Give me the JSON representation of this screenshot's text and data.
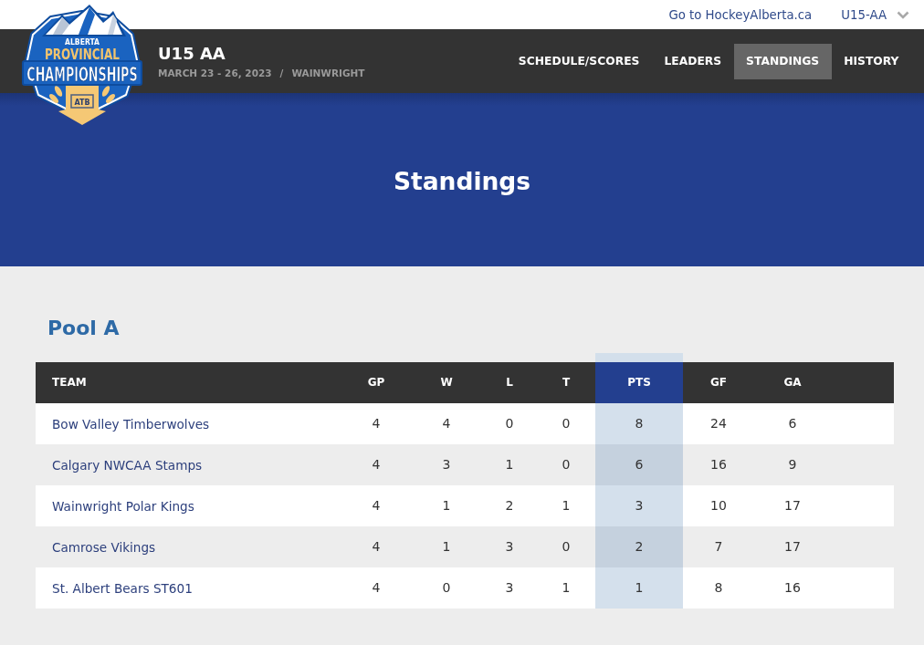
{
  "top_bar": {
    "site_link": "Go to HockeyAlberta.ca",
    "division_select": {
      "value": "U15-AA"
    }
  },
  "logo": {
    "line_1": "ALBERTA",
    "line_2": "PROVINCIAL",
    "line_3": "CHAMPIONSHIPS",
    "badge": "ATB"
  },
  "event": {
    "title": "U15 AA",
    "dates": "MARCH 23 - 26, 2023",
    "separator": "/",
    "location": "WAINWRIGHT"
  },
  "nav": [
    {
      "label": "SCHEDULE/SCORES",
      "selected": false
    },
    {
      "label": "LEADERS",
      "selected": false
    },
    {
      "label": "STANDINGS",
      "selected": true
    },
    {
      "label": "HISTORY",
      "selected": false
    }
  ],
  "hero": {
    "title": "Standings"
  },
  "pools": [
    {
      "title": "Pool A",
      "table": {
        "columns": [
          {
            "label": "TEAM",
            "highlighted": false
          },
          {
            "label": "GP",
            "highlighted": false
          },
          {
            "label": "W",
            "highlighted": false
          },
          {
            "label": "L",
            "highlighted": false
          },
          {
            "label": "T",
            "highlighted": false
          },
          {
            "label": "PTS",
            "highlighted": true
          },
          {
            "label": "GF",
            "highlighted": false
          },
          {
            "label": "GA",
            "highlighted": false
          }
        ],
        "rows": [
          {
            "team": "Bow Valley Timberwolves",
            "stats": [
              "4",
              "4",
              "0",
              "0",
              "8",
              "24",
              "6"
            ]
          },
          {
            "team": "Calgary NWCAA Stamps",
            "stats": [
              "4",
              "3",
              "1",
              "0",
              "6",
              "16",
              "9"
            ]
          },
          {
            "team": "Wainwright Polar Kings",
            "stats": [
              "4",
              "1",
              "2",
              "1",
              "3",
              "10",
              "17"
            ]
          },
          {
            "team": "Camrose Vikings",
            "stats": [
              "4",
              "1",
              "3",
              "0",
              "2",
              "7",
              "17"
            ]
          },
          {
            "team": "St. Albert Bears ST601",
            "stats": [
              "4",
              "0",
              "3",
              "1",
              "1",
              "8",
              "16"
            ]
          }
        ]
      }
    }
  ]
}
